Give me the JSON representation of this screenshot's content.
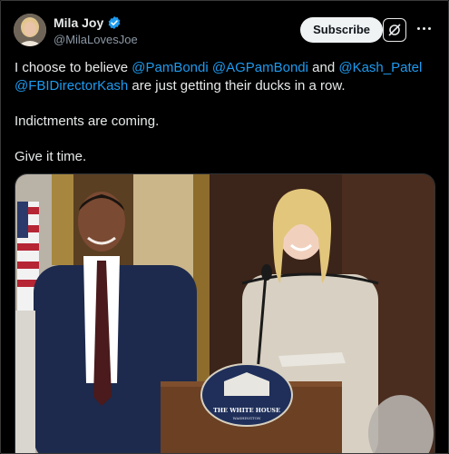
{
  "post": {
    "display_name": "Mila Joy",
    "handle": "@MilaLovesJoe",
    "subscribe_label": "Subscribe",
    "text": {
      "line1_pre": "I choose to believe ",
      "mention1": "@PamBondi",
      "space1": " ",
      "mention2": "@AGPamBondi",
      "and": " and ",
      "mention3": "@Kash_Patel",
      "space2": " ",
      "mention4": "@FBIDirectorKash",
      "line1_post": " are just getting their ducks in a row.",
      "paragraph2": "Indictments are coming.",
      "paragraph3": "Give it time."
    }
  },
  "media": {
    "podium_seal_text": "THE WHITE HOUSE",
    "podium_seal_subtext": "WASHINGTON"
  },
  "colors": {
    "background": "#000000",
    "text": "#e7e9ea",
    "secondary_text": "#8b98a5",
    "link": "#1d9bf0",
    "verified": "#1d9bf0",
    "subscribe_bg": "#eff3f4"
  },
  "icons": {
    "verified": "verified-badge-icon",
    "grok": "grok-icon",
    "more": "more-horizontal-icon"
  }
}
